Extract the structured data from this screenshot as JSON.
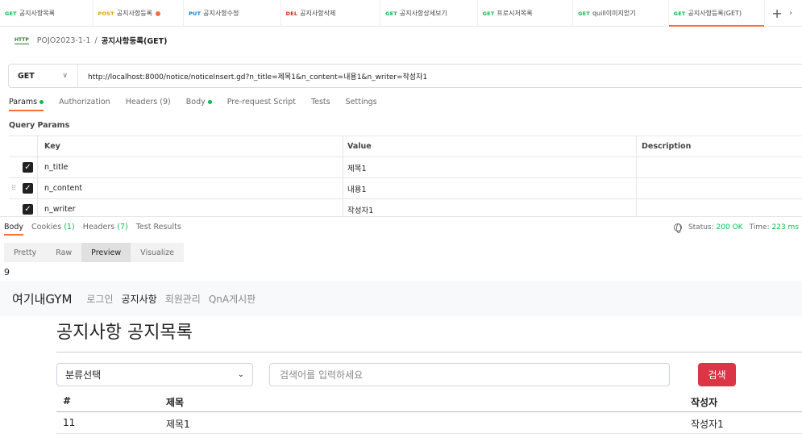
{
  "tabs": [
    {
      "method": "GET",
      "color": "#0cbb52",
      "name": "공지사항목록",
      "active": false,
      "unsaved": false
    },
    {
      "method": "POST",
      "color": "#e5a100",
      "name": "공지사항등록",
      "active": false,
      "unsaved": true
    },
    {
      "method": "PUT",
      "color": "#097bed",
      "name": "공지사항수정",
      "active": false,
      "unsaved": false
    },
    {
      "method": "DEL",
      "color": "#eb2013",
      "name": "공지사항삭제",
      "active": false,
      "unsaved": false
    },
    {
      "method": "GET",
      "color": "#0cbb52",
      "name": "공지사항상세보기",
      "active": false,
      "unsaved": false
    },
    {
      "method": "GET",
      "color": "#0cbb52",
      "name": "프로시저목록",
      "active": false,
      "unsaved": false
    },
    {
      "method": "GET",
      "color": "#0cbb52",
      "name": "quill이미지얻기",
      "active": false,
      "unsaved": false
    },
    {
      "method": "GET",
      "color": "#0cbb52",
      "name": "공지사항등록(GET)",
      "active": true,
      "unsaved": false
    }
  ],
  "tab_plus": "+",
  "breadcrumb": {
    "icon_text": "HTTP",
    "collection": "POJO2023-1-1",
    "sep": "/",
    "current": "공지사항등록(GET)"
  },
  "request": {
    "method": "GET",
    "url": "http://localhost:8000/notice/noticeInsert.gd?n_title=제목1&n_content=내용1&n_writer=작성자1"
  },
  "request_tabs": {
    "params": "Params",
    "authorization": "Authorization",
    "headers": "Headers",
    "headers_count": "(9)",
    "body": "Body",
    "prerequest": "Pre-request Script",
    "tests": "Tests",
    "settings": "Settings"
  },
  "query_params": {
    "title": "Query Params",
    "headers": {
      "key": "Key",
      "value": "Value",
      "description": "Description"
    },
    "rows": [
      {
        "key": "n_title",
        "value": "제목1",
        "description": ""
      },
      {
        "key": "n_content",
        "value": "내용1",
        "description": ""
      },
      {
        "key": "n_writer",
        "value": "작성자1",
        "description": ""
      }
    ]
  },
  "response_tabs": {
    "body": "Body",
    "cookies": "Cookies",
    "cookies_count": "(1)",
    "headers": "Headers",
    "headers_count": "(7)",
    "test_results": "Test Results"
  },
  "status": {
    "status_label": "Status:",
    "status_value": "200 OK",
    "time_label": "Time:",
    "time_value": "223 ms"
  },
  "format_tabs": [
    "Pretty",
    "Raw",
    "Preview",
    "Visualize"
  ],
  "response_prefix": "9",
  "preview": {
    "brand": "여기내GYM",
    "nav": [
      {
        "label": "로그인",
        "active": false
      },
      {
        "label": "공지사항",
        "active": true
      },
      {
        "label": "회원관리",
        "active": false
      },
      {
        "label": "QnA게시판",
        "active": false
      }
    ],
    "page_title": "공지사항 공지목록",
    "select_value": "분류선택",
    "search_placeholder": "검색어를 입력하세요",
    "search_button": "검색",
    "table_headers": {
      "no": "#",
      "title": "제목",
      "writer": "작성자"
    },
    "table_rows": [
      {
        "no": "11",
        "title": "제목1",
        "writer": "작성자1"
      }
    ]
  }
}
